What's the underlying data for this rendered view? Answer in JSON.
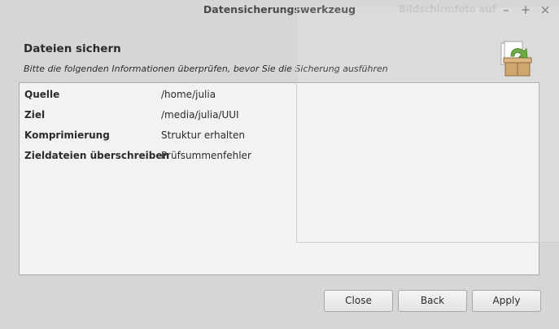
{
  "window": {
    "title": "Datensicherungswerkzeug",
    "background_title": "Bildschirmfoto aufnehmen",
    "minimize_symbol": "–",
    "maximize_symbol": "+",
    "close_symbol": "×"
  },
  "header": {
    "heading": "Dateien sichern",
    "subheading": "Bitte die folgenden Informationen überprüfen, bevor Sie die Sicherung ausführen",
    "icon": "backup-box-icon"
  },
  "summary": {
    "rows": [
      {
        "label": "Quelle",
        "value": "/home/julia"
      },
      {
        "label": "Ziel",
        "value": "/media/julia/UUI"
      },
      {
        "label": "Komprimierung",
        "value": "Struktur erhalten"
      },
      {
        "label": "Zieldateien überschreiben",
        "value": "Prüfsummenfehler"
      }
    ]
  },
  "buttons": {
    "close": "Close",
    "back": "Back",
    "apply": "Apply"
  },
  "colors": {
    "window_bg": "#d6d6d6",
    "panel_bg": "#f2f2f2",
    "icon_green": "#5aa02c",
    "icon_box": "#c99a5b"
  }
}
